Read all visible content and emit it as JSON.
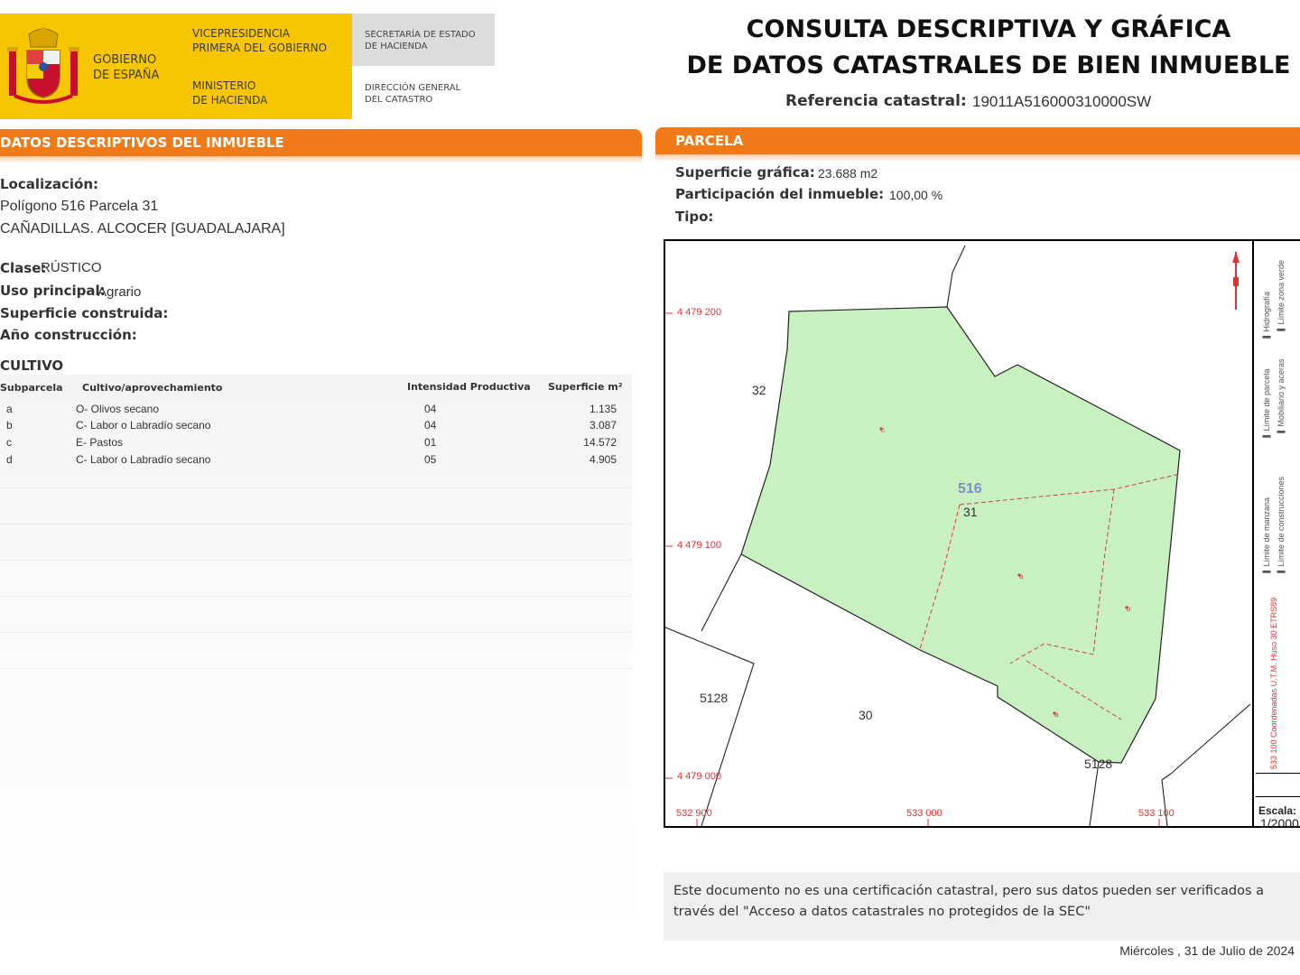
{
  "header": {
    "gobierno": "GOBIERNO\nDE ESPAÑA",
    "vicepresidencia": "VICEPRESIDENCIA\nPRIMERA DEL GOBIERNO",
    "ministerio": "MINISTERIO\nDE HACIENDA",
    "secretaria": "SECRETARÍA DE ESTADO\nDE HACIENDA",
    "direccion": "DIRECCIÓN GENERAL\nDEL CATASTRO",
    "title_line1": "CONSULTA DESCRIPTIVA Y GRÁFICA",
    "title_line2": "DE DATOS CATASTRALES DE BIEN INMUEBLE",
    "ref_label": "Referencia catastral:",
    "ref_value": "19011A516000310000SW",
    "brand_colors": {
      "yellow": "#f7c600",
      "orange": "#f07a18"
    }
  },
  "left": {
    "section_title": "DATOS DESCRIPTIVOS DEL INMUEBLE",
    "localizacion_label": "Localización:",
    "localizacion_line1": "Polígono 516 Parcela 31",
    "localizacion_line2": "CAÑADILLAS. ALCOCER [GUADALAJARA]",
    "clase_label": "Clase:",
    "clase_value": "RÚSTICO",
    "uso_label": "Uso principal:",
    "uso_value": "Agrario",
    "superficie_construida_label": "Superficie construida:",
    "anio_label": "Año construcción:",
    "cultivo_title": "CULTIVO",
    "table": {
      "headers": [
        "Subparcela",
        "Cultivo/aprovechamiento",
        "Intensidad Productiva",
        "Superficie m²"
      ],
      "rows": [
        [
          "a",
          "O- Olivos secano",
          "04",
          "1.135"
        ],
        [
          "b",
          "C- Labor o Labradío secano",
          "04",
          "3.087"
        ],
        [
          "c",
          "E- Pastos",
          "01",
          "14.572"
        ],
        [
          "d",
          "C- Labor o Labradío secano",
          "05",
          "4.905"
        ]
      ]
    }
  },
  "right": {
    "section_title": "PARCELA",
    "superficie_label": "Superficie gráfica:",
    "superficie_value": "23.688 m2",
    "participacion_label": "Participación del inmueble:",
    "participacion_value": "100,00 %",
    "tipo_label": "Tipo:",
    "map": {
      "coords_y": [
        "4 479 200",
        "4 479 100",
        "4 479 000"
      ],
      "coords_x": [
        "532 900",
        "533 000",
        "533 100"
      ],
      "poligono": "516",
      "parcela": "31",
      "neighbors": [
        "32",
        "5128",
        "30",
        "5128"
      ],
      "subparcel_letters": [
        "c",
        "a",
        "b",
        "a"
      ],
      "colors": {
        "parcel_fill": "#c8f0c0",
        "subparcel_line": "#d04040",
        "coord_text": "#d33333",
        "poligono_text": "#7c8fc4"
      }
    },
    "legend": {
      "items": [
        "Límite de manzana",
        "Límite de parcela",
        "Límite de construcciones",
        "Mobiliario y aceras",
        "Límite zona verde",
        "Hidrografía"
      ],
      "utm": "533 100 Coordenadas U.T.M. Huso 30 ETRS89",
      "escala_label": "Escala:",
      "escala_value": "1/2000"
    },
    "notice": "Este documento no es una certificación catastral, pero sus datos pueden ser verificados a través del \"Acceso a datos catastrales no protegidos de la SEC\"",
    "date": "Miércoles , 31 de Julio de 2024"
  }
}
